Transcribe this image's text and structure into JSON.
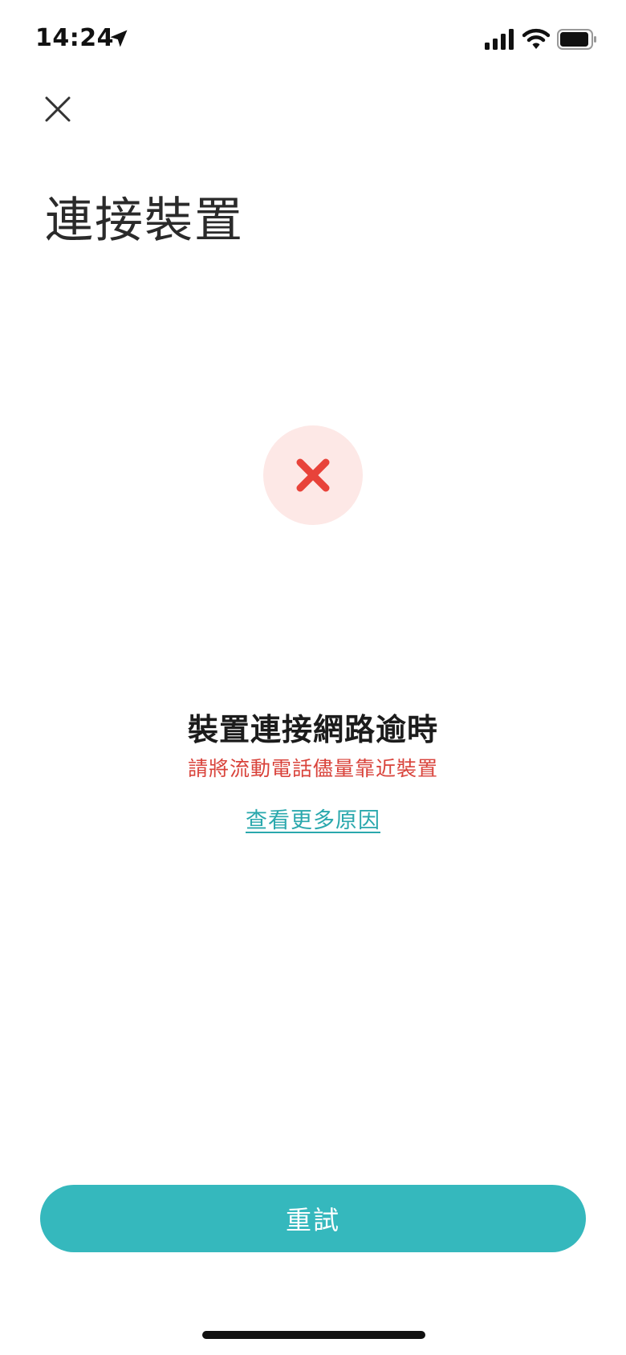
{
  "status_bar": {
    "time": "14:24",
    "icons": [
      "location-arrow-icon",
      "cellular-signal-icon",
      "wifi-icon",
      "battery-icon"
    ]
  },
  "header": {
    "close_icon": "close-icon",
    "title": "連接裝置"
  },
  "status": {
    "icon": "error-x-icon",
    "colors": {
      "icon": "#e8433a",
      "icon_background": "#fde8e6"
    },
    "title": "裝置連接網路逾時",
    "hint": "請將流動電話儘量靠近裝置",
    "more_link": "查看更多原因"
  },
  "actions": {
    "retry_label": "重試"
  },
  "colors": {
    "accent": "#35b8bd",
    "link": "#2aa8ad",
    "error_text": "#d9433b"
  }
}
